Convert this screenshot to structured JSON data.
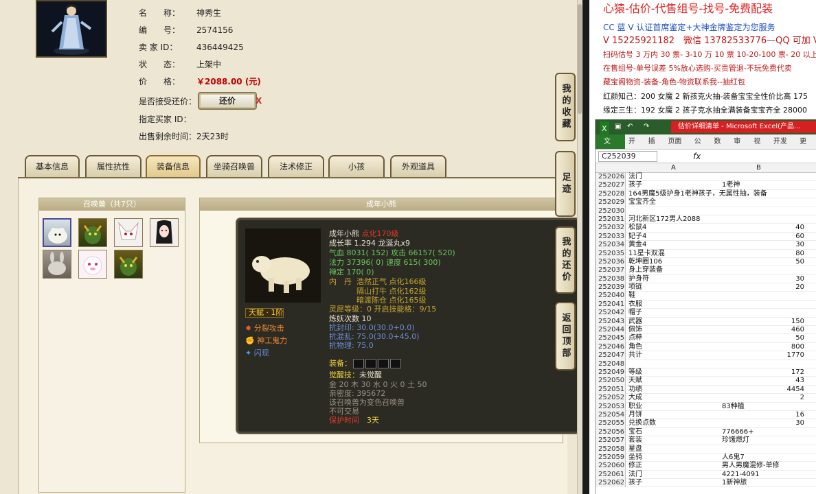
{
  "pet_info": {
    "name_label": "名　　称：",
    "name": "神秀生",
    "id_label": "编　　号：",
    "id": "2574156",
    "seller_label": "卖 家  ID：",
    "seller_id": "436449425",
    "status_label": "状　　态：",
    "status": "上架中",
    "price_label": "价　　格：",
    "price": "￥2088.00 (元)",
    "counter_label": "是否接受还价：",
    "counter_button": "还价",
    "counter_x": "X",
    "buyer_label": "指定买家 ID：",
    "buyer_id": "",
    "remaining_label": "出售剩余时间：",
    "remaining": "2天23时"
  },
  "tabs": [
    "基本信息",
    "属性抗性",
    "装备信息",
    "坐骑召唤兽",
    "法术修正",
    "小孩",
    "外观道具"
  ],
  "pet_list": {
    "title": "召唤兽（共7只）"
  },
  "detail": {
    "title": "成年小熊"
  },
  "tooltip": {
    "name": "成年小熊",
    "enhance": "点化170级",
    "growth": "成长率 1.294 龙涎丸x9",
    "hp": "气血 8031( 152) 攻击 66157( 520)",
    "mp": "法力 37396( 0) 速度 615( 300)",
    "zen": "禅定 170( 0)",
    "inner_label": "内　丹",
    "inner1": "浩然正气 点化166级",
    "inner2": "隔山打牛 点化162级",
    "inner3": "暗渡陈仓 点化165级",
    "talent": "天赋 · 1阶",
    "skill1": "分裂攻击",
    "skill2": "神工鬼力",
    "skill3": "闪现",
    "spirit": "灵犀等级：0 开启技能格：9/15",
    "refine": "炼妖次数 10",
    "res1": "抗封印: 30.0(30.0+0.0)",
    "res2": "抗混乱: 75.0(30.0+45.0)",
    "res3": "抗物理: 75.0",
    "equip_label": "装备：",
    "awaken_label": "觉醒技：",
    "awaken": "未觉醒",
    "elements": "金 20 木 30 水 0 火 0 土 50",
    "intimacy": "亲密度: 395672",
    "variant": "该召唤兽为变色召唤兽",
    "trade": "不可交易",
    "protect_label": "保护时间",
    "protect": "3天"
  },
  "side_buttons": [
    "我的收藏",
    "足迹",
    "我的还价",
    "返回顶部"
  ],
  "ad": {
    "headline": "心猿-估价-代售组号-找号-免费配装",
    "line1": "CC 蓝 V 认证首席鉴定+大神金牌鉴定为您服务",
    "line2": "V 15225921182　微信 13782533776—QQ 可加 V",
    "line3": "扫码估号 3 万内 30 票- 3-10 万 10 票  10-20-100 票- 20 以上 150",
    "line4": "在售组号-单号误差 5%放心选购-买贵管退-不玩免费代卖",
    "line5": "藏宝阁物资-装备-角色-物资联系我--抽红包",
    "line6": "红颜知己：200 女魔 2 新孩克火抽-装备宝宝全性价比高 175",
    "line7": "缘定三生：192 女魔 2 孩子克水抽全满装备宝宝齐全 28000"
  },
  "excel": {
    "title": "估价详细清单 - Microsoft Excel(产品...",
    "ribbon": [
      "文件",
      "开始",
      "插入",
      "页面布",
      "公式",
      "数据",
      "审阅",
      "视图",
      "开发工",
      "更多"
    ],
    "name_box": "C252039",
    "fx": "fx",
    "col_a": "A",
    "col_b": "B",
    "rows": [
      [
        "252026",
        "法门",
        ""
      ],
      [
        "252027",
        "孩子",
        "1老神"
      ],
      [
        "252028",
        "164男魔5级护身1老神孩子，无属性抽，装备",
        ""
      ],
      [
        "252029",
        "宝宝齐全",
        ""
      ],
      [
        "252030",
        "",
        ""
      ],
      [
        "252031",
        "河北新区172男人2088",
        ""
      ],
      [
        "252032",
        "松鼠4",
        "40"
      ],
      [
        "252033",
        "妃子4",
        "60"
      ],
      [
        "252034",
        "黄金4",
        "30"
      ],
      [
        "252035",
        "11星卡双混",
        "80"
      ],
      [
        "252036",
        "乾坤圈106",
        "50"
      ],
      [
        "252037",
        "身上穿装备",
        ""
      ],
      [
        "252038",
        "护身符",
        "30"
      ],
      [
        "252039",
        "项链",
        "20"
      ],
      [
        "252040",
        "鞋",
        ""
      ],
      [
        "252041",
        "衣服",
        ""
      ],
      [
        "252042",
        "帽子",
        ""
      ],
      [
        "252043",
        "武器",
        "150"
      ],
      [
        "252044",
        "佩饰",
        "460"
      ],
      [
        "252045",
        "点粹",
        "50"
      ],
      [
        "252046",
        "角色",
        "800"
      ],
      [
        "252047",
        "共计",
        "1770"
      ],
      [
        "252048",
        "",
        ""
      ],
      [
        "252049",
        "等级",
        "172"
      ],
      [
        "252050",
        "天赋",
        "43"
      ],
      [
        "252051",
        "功绩",
        "4454"
      ],
      [
        "252052",
        "大成",
        "2"
      ],
      [
        "252053",
        "职业",
        "83种植"
      ],
      [
        "252054",
        "月饼",
        "16"
      ],
      [
        "252055",
        "兑换点数",
        "30"
      ],
      [
        "252056",
        "宝石",
        "776666+"
      ],
      [
        "252057",
        "套装",
        "珍馐燃灯"
      ],
      [
        "252058",
        "星盘",
        ""
      ],
      [
        "252059",
        "坐骑",
        "人6鬼7"
      ],
      [
        "252060",
        "修正",
        "男人男魔混修-单修"
      ],
      [
        "252061",
        "法门",
        "4221-4091"
      ],
      [
        "252062",
        "孩子",
        "1新神旅"
      ]
    ]
  }
}
